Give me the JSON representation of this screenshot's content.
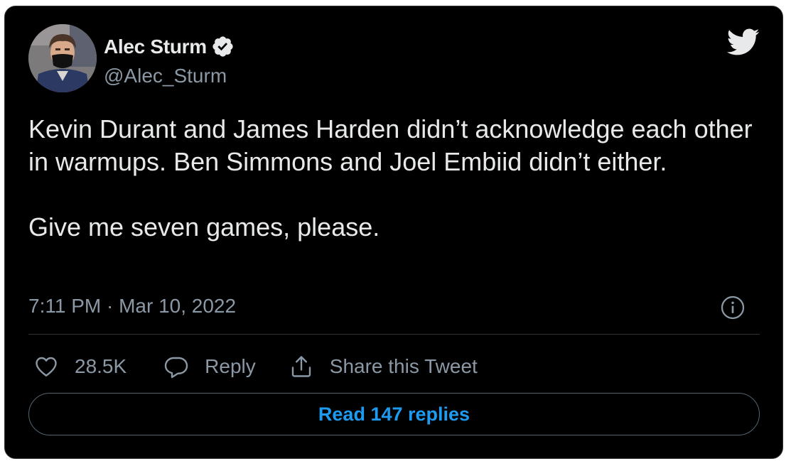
{
  "author": {
    "display_name": "Alec Sturm",
    "handle": "@Alec_Sturm",
    "verified": true,
    "avatar_icon": "profile-photo-masked-man"
  },
  "brand": {
    "icon": "twitter-bird-icon"
  },
  "tweet": {
    "text": "Kevin Durant and James Harden didn’t acknowledge each other in warmups. Ben Simmons and Joel Embiid didn’t either.\n\nGive me seven games, please.",
    "timestamp": "7:11 PM · Mar 10, 2022"
  },
  "actions": {
    "like_count": "28.5K",
    "reply_label": "Reply",
    "share_label": "Share this Tweet"
  },
  "footer": {
    "read_replies_label": "Read 147 replies"
  },
  "colors": {
    "background": "#000000",
    "text_primary": "#e7e9ea",
    "text_secondary": "#8b98a5",
    "accent": "#1d9bf0",
    "border": "#2f3336"
  }
}
